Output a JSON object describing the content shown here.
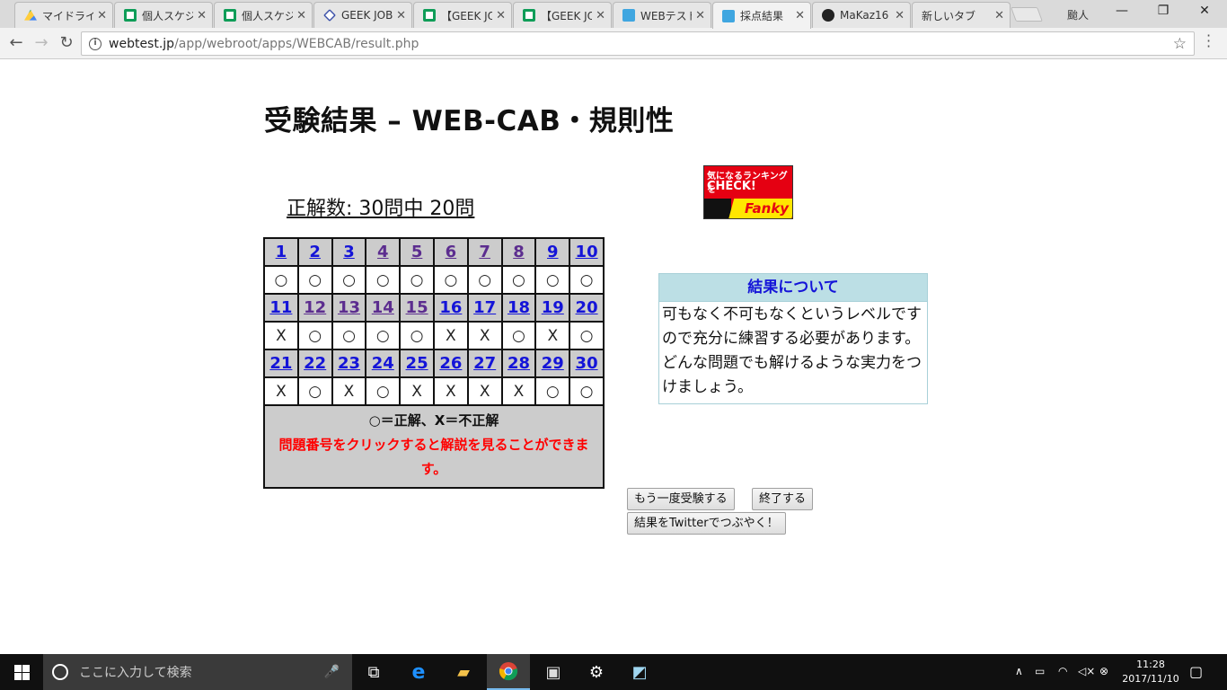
{
  "browser": {
    "tabs": [
      {
        "label": "マイドライブ",
        "icon": "drive-icon"
      },
      {
        "label": "個人スケジ",
        "icon": "sheet-icon"
      },
      {
        "label": "個人スケジ",
        "icon": "sheet-icon"
      },
      {
        "label": "GEEK JOB",
        "icon": "geekjob-icon"
      },
      {
        "label": "【GEEK JO",
        "icon": "sheet-icon"
      },
      {
        "label": "【GEEK JO",
        "icon": "sheet-icon"
      },
      {
        "label": "WEBテスト",
        "icon": "webtest-icon"
      },
      {
        "label": "採点結果",
        "icon": "webtest-icon",
        "active": true
      },
      {
        "label": "MaKaz16",
        "icon": "github-icon"
      },
      {
        "label": "新しいタブ",
        "icon": ""
      }
    ],
    "profile_name": "颱人",
    "url_host": "webtest.jp",
    "url_path": "/app/webroot/apps/WEBCAB/result.php"
  },
  "page": {
    "title": "受験結果 – WEB-CAB・規則性",
    "score_text": "正解数: 30問中 20問",
    "correct_mark": "○",
    "incorrect_mark": "X",
    "questions": [
      {
        "n": "1",
        "r": "○",
        "v": false
      },
      {
        "n": "2",
        "r": "○",
        "v": false
      },
      {
        "n": "3",
        "r": "○",
        "v": false
      },
      {
        "n": "4",
        "r": "○",
        "v": true
      },
      {
        "n": "5",
        "r": "○",
        "v": true
      },
      {
        "n": "6",
        "r": "○",
        "v": true
      },
      {
        "n": "7",
        "r": "○",
        "v": true
      },
      {
        "n": "8",
        "r": "○",
        "v": true
      },
      {
        "n": "9",
        "r": "○",
        "v": false
      },
      {
        "n": "10",
        "r": "○",
        "v": false
      },
      {
        "n": "11",
        "r": "X",
        "v": false
      },
      {
        "n": "12",
        "r": "○",
        "v": true
      },
      {
        "n": "13",
        "r": "○",
        "v": true
      },
      {
        "n": "14",
        "r": "○",
        "v": true
      },
      {
        "n": "15",
        "r": "○",
        "v": true
      },
      {
        "n": "16",
        "r": "X",
        "v": false
      },
      {
        "n": "17",
        "r": "X",
        "v": false
      },
      {
        "n": "18",
        "r": "○",
        "v": false
      },
      {
        "n": "19",
        "r": "X",
        "v": false
      },
      {
        "n": "20",
        "r": "○",
        "v": false
      },
      {
        "n": "21",
        "r": "X",
        "v": false
      },
      {
        "n": "22",
        "r": "○",
        "v": false
      },
      {
        "n": "23",
        "r": "X",
        "v": false
      },
      {
        "n": "24",
        "r": "○",
        "v": false
      },
      {
        "n": "25",
        "r": "X",
        "v": false
      },
      {
        "n": "26",
        "r": "X",
        "v": false
      },
      {
        "n": "27",
        "r": "X",
        "v": false
      },
      {
        "n": "28",
        "r": "X",
        "v": false
      },
      {
        "n": "29",
        "r": "○",
        "v": false
      },
      {
        "n": "30",
        "r": "○",
        "v": false
      }
    ],
    "legend": "○＝正解、X＝不正解",
    "note": "問題番号をクリックすると解説を見ることができます。",
    "banner": {
      "line1": "気になるランキングを",
      "line2": "CHECK!",
      "brand": "Fanky"
    },
    "about": {
      "heading": "結果について",
      "body1": "可もなく不可もなくというレベルですので充分に練習する必要があります。",
      "body2": "どんな問題でも解けるような実力をつけましょう。"
    },
    "buttons": {
      "retry": "もう一度受験する",
      "finish": "終了する",
      "tweet": "結果をTwitterでつぶやく！"
    }
  },
  "taskbar": {
    "search_placeholder": "ここに入力して検索",
    "time": "11:28",
    "date": "2017/11/10"
  },
  "colors": {
    "link": "#1414d8",
    "visited_link": "#5c2d8f",
    "note_red": "#ff0000",
    "header_cell": "#cccccc",
    "about_header": "#bcdfe5"
  }
}
